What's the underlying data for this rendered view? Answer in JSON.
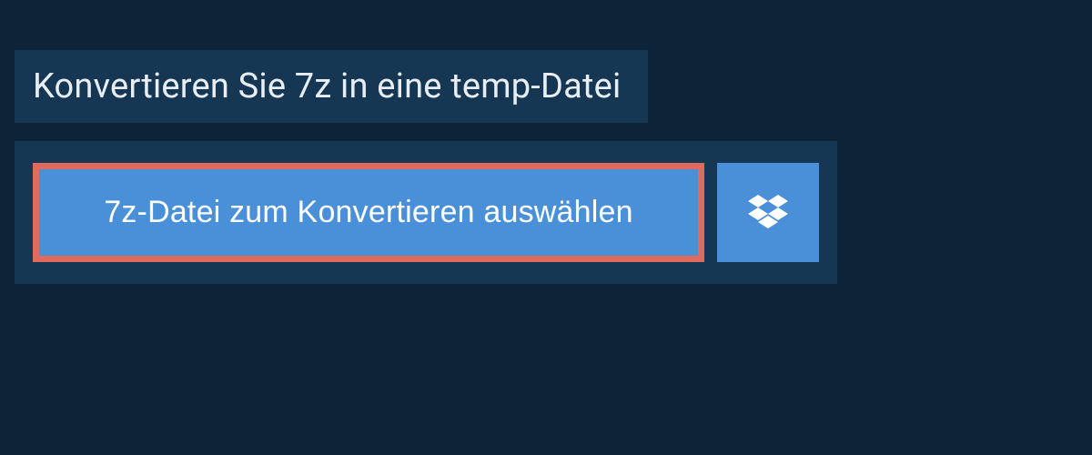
{
  "header": {
    "title": "Konvertieren Sie 7z in eine temp-Datei"
  },
  "controls": {
    "select_file_label": "7z-Datei zum Konvertieren auswählen",
    "dropbox_icon": "dropbox-icon"
  },
  "colors": {
    "page_bg": "#0d2438",
    "panel_bg": "#163754",
    "button_bg": "#4a90d9",
    "highlight_border": "#e06a5e",
    "text_light": "#e8eef3"
  }
}
